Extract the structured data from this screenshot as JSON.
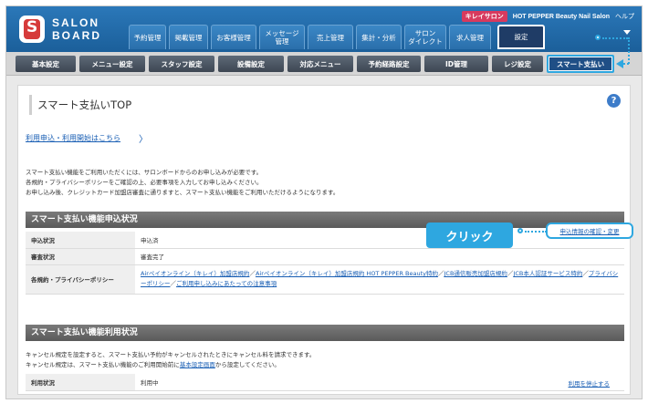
{
  "header": {
    "logo_line1": "SALON",
    "logo_line2": "BOARD",
    "kirei_badge": "キレイサロン",
    "salon_name": "HOT PEPPER Beauty Nail Salon",
    "help": "ヘルプ"
  },
  "main_nav": [
    {
      "label": "予約管理"
    },
    {
      "label": "掲載管理"
    },
    {
      "label": "お客様管理"
    },
    {
      "label": "メッセージ\n管理"
    },
    {
      "label": "売上管理"
    },
    {
      "label": "集計・分析"
    },
    {
      "label": "サロン\nダイレクト"
    },
    {
      "label": "求人管理"
    },
    {
      "label": "設定"
    }
  ],
  "sub_nav": [
    {
      "label": "基本設定"
    },
    {
      "label": "メニュー設定"
    },
    {
      "label": "スタッフ設定"
    },
    {
      "label": "設備設定"
    },
    {
      "label": "対応メニュー"
    },
    {
      "label": "予約経路設定"
    },
    {
      "label": "ID管理"
    },
    {
      "label": "レジ設定"
    },
    {
      "label": "スマート支払い"
    }
  ],
  "page": {
    "title": "スマート支払いTOP",
    "help_icon": "?",
    "apply_link": "利用申込・利用開始はこちら",
    "apply_chevron": "〉",
    "intro_lines": [
      "スマート支払い機能をご利用いただくには、サロンボードからのお申し込みが必要です。",
      "各規約・プライバシーポリシーをご確認の上、必要事項を入力してお申し込みください。",
      "お申し込み後、クレジットカード加盟店審査に通りますと、スマート支払い機能をご利用いただけるようになります。"
    ]
  },
  "section_apply": {
    "title": "スマート支払い機能申込状況",
    "rows": {
      "apply_label": "申込状況",
      "apply_value": "申込済",
      "review_label": "審査状況",
      "review_value": "審査完了",
      "terms_label": "各規約・プライバシーポリシー",
      "terms_links": [
        "Airペイオンライン（キレイ）加盟店規約",
        "Airペイオンライン（キレイ）加盟店規約 HOT PEPPER Beauty特約",
        "JCB通信販売加盟店規約",
        "JCB本人認証サービス特約",
        "プライバシーポリシー",
        "ご利用申し込みにあたっての注意事項"
      ],
      "terms_sep": "／"
    },
    "check_link": "申込情報の確認・変更"
  },
  "callout": {
    "click_label": "クリック"
  },
  "section_usage": {
    "title": "スマート支払い機能利用状況",
    "text_line1": "キャンセル規定を設定すると、スマート支払い予約がキャンセルされたときにキャンセル料を請求できます。",
    "text_line2_pre": "キャンセル規定は、スマート支払い機能のご利用開始前に",
    "text_line2_link": "基本設定画面",
    "text_line2_post": "から設定してください。",
    "usage_label": "利用状況",
    "usage_value": "利用中",
    "stop_link": "利用を停止する"
  }
}
